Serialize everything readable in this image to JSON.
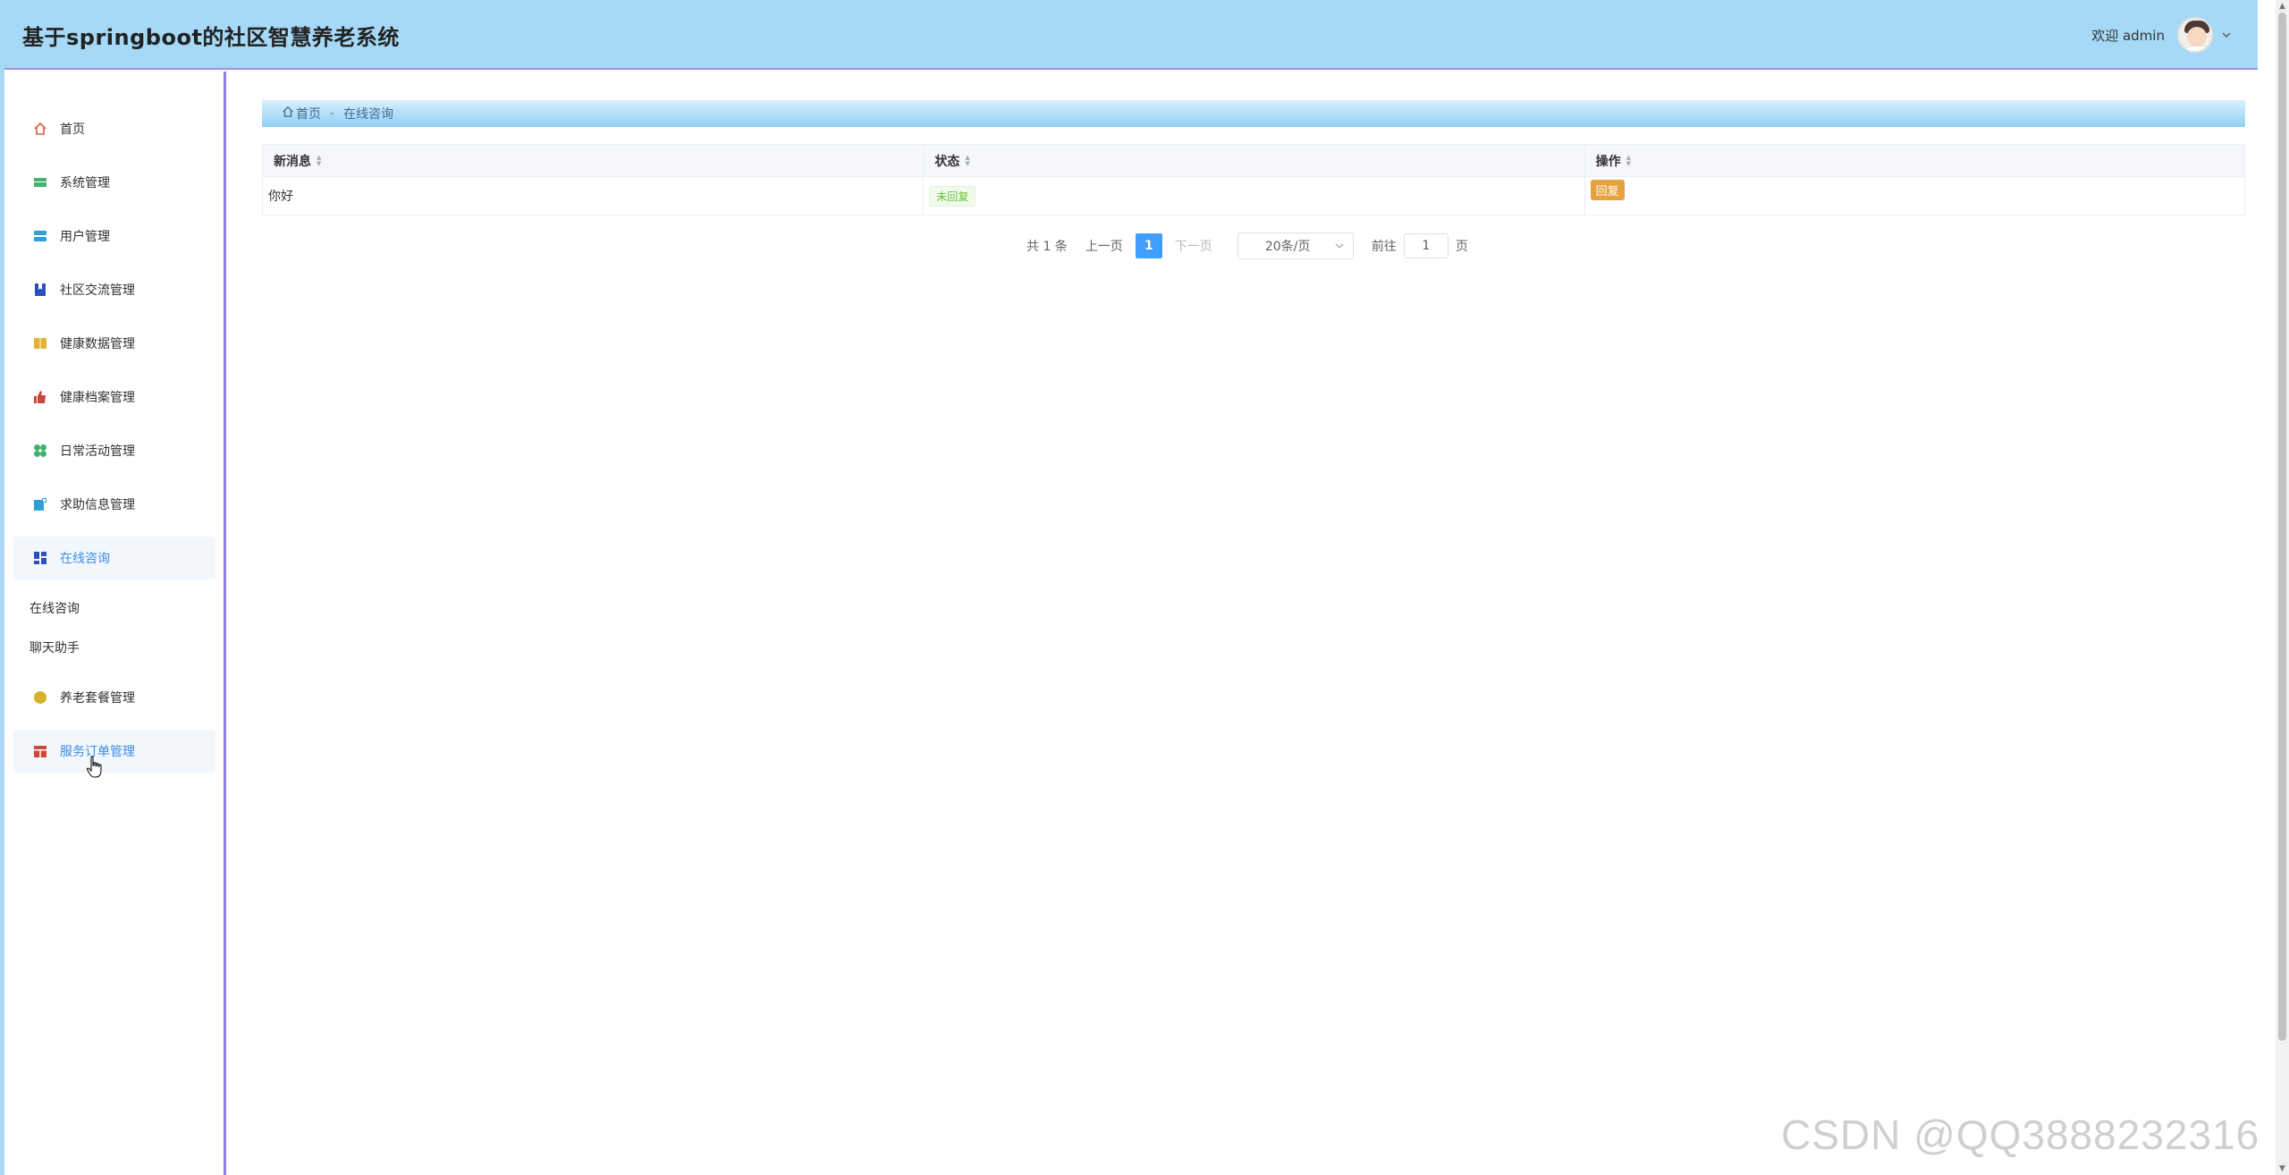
{
  "header": {
    "title": "基于springboot的社区智慧养老系统",
    "welcome": "欢迎 admin"
  },
  "sidebar": {
    "items": [
      {
        "label": "首页",
        "icon": "home-icon",
        "color": "#e05a45"
      },
      {
        "label": "系统管理",
        "icon": "system-icon",
        "color": "#43b36e"
      },
      {
        "label": "用户管理",
        "icon": "user-icon",
        "color": "#2f9fd6"
      },
      {
        "label": "社区交流管理",
        "icon": "bookmark-icon",
        "color": "#2c4fbf"
      },
      {
        "label": "健康数据管理",
        "icon": "book-icon",
        "color": "#e2b22e"
      },
      {
        "label": "健康档案管理",
        "icon": "thumbs-up-icon",
        "color": "#c9453a"
      },
      {
        "label": "日常活动管理",
        "icon": "clover-icon",
        "color": "#3fb36a"
      },
      {
        "label": "求助信息管理",
        "icon": "message-icon",
        "color": "#2f9fd6"
      },
      {
        "label": "在线咨询",
        "icon": "dashboard-icon",
        "color": "#2c4fbf"
      },
      {
        "label": "养老套餐管理",
        "icon": "circle-icon",
        "color": "#d6b22e"
      },
      {
        "label": "服务订单管理",
        "icon": "calendar-icon",
        "color": "#d0453a"
      }
    ],
    "sub_items": [
      "在线咨询",
      "聊天助手"
    ]
  },
  "breadcrumb": {
    "home": "首页",
    "separator": "-",
    "current": "在线咨询"
  },
  "table": {
    "columns": [
      "新消息",
      "状态",
      "操作"
    ],
    "rows": [
      {
        "message": "你好",
        "status": "未回复",
        "action": "回复"
      }
    ]
  },
  "pagination": {
    "total": "共 1 条",
    "prev": "上一页",
    "current_page": "1",
    "next": "下一页",
    "page_size": "20条/页",
    "goto_label": "前往",
    "goto_value": "1",
    "goto_suffix": "页"
  },
  "watermark": "CSDN @QQ3888232316",
  "colors": {
    "header_bg": "#a6d9f7",
    "accent": "#409eff",
    "sidebar_border": "#8e7ee0",
    "status_tag": "#67c23a",
    "reply_button": "#e6a23c"
  }
}
